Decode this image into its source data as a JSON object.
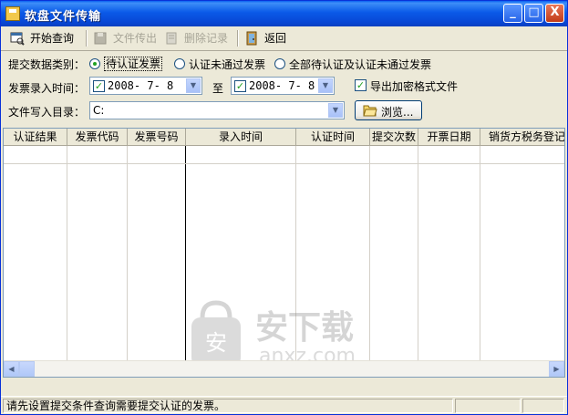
{
  "window": {
    "title": "软盘文件传输"
  },
  "titlebar": {
    "minimize": "_",
    "maximize": "□",
    "close": "X"
  },
  "toolbar": {
    "start_query": "开始查询",
    "export_file": "文件传出",
    "delete_record": "删除记录",
    "back": "返回"
  },
  "form": {
    "category_label": "提交数据类别：",
    "radio_pending": "待认证发票",
    "radio_failed": "认证未通过发票",
    "radio_all": "全部待认证及认证未通过发票",
    "time_label": "发票录入时间：",
    "date_from": "2008- 7- 8",
    "to_label": "至",
    "date_to": "2008- 7- 8",
    "export_encrypted": "导出加密格式文件",
    "dir_label": "文件写入目录：",
    "dir_value": "C:",
    "browse": "浏览..."
  },
  "grid": {
    "columns": [
      "认证结果",
      "发票代码",
      "发票号码",
      "录入时间",
      "认证时间",
      "提交次数",
      "开票日期",
      "销货方税务登记"
    ]
  },
  "watermark": {
    "text_cn": "安下载",
    "text_en": "anxz.com"
  },
  "status": {
    "message": "请先设置提交条件查询需要提交认证的发票。"
  },
  "colors": {
    "titlebar": "#0A5AE8",
    "face": "#ECE9D8",
    "check": "#21A121"
  }
}
